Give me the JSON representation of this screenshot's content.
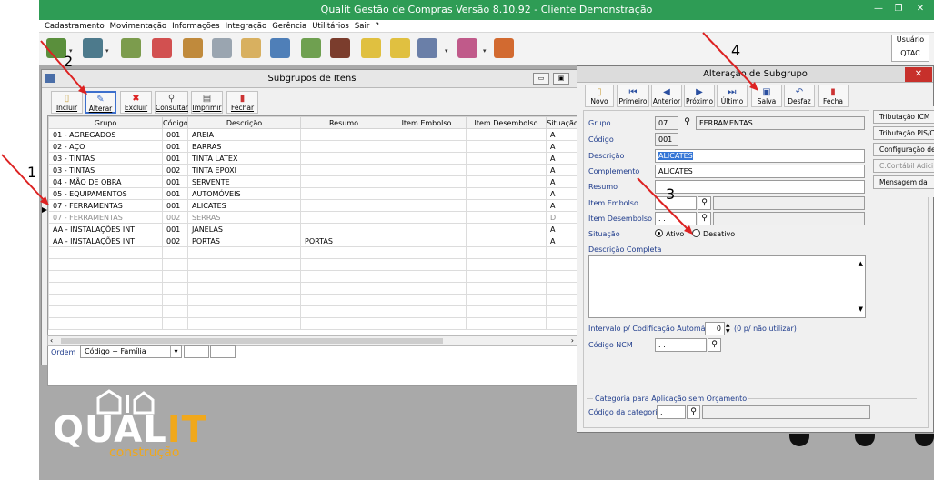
{
  "app": {
    "title": "Qualit Gestão de Compras Versão 8.10.92 - Cliente Demonstração",
    "menu": [
      "Cadastramento",
      "Movimentação",
      "Informações",
      "Integração",
      "Gerência",
      "Utilitários",
      "Sair",
      "?"
    ],
    "user_label": "Usuário",
    "user_value": "QTAC"
  },
  "colors": {
    "titlebar": "#2e9c55",
    "accent": "#1f3c8c",
    "close": "#c7302b",
    "logo_orange": "#f0a81c"
  },
  "subgroups": {
    "title": "Subgrupos de Itens",
    "buttons": [
      "Incluir",
      "Alterar",
      "Excluir",
      "Consultar",
      "Imprimir",
      "Fechar"
    ],
    "columns": [
      "Grupo",
      "Código",
      "Descrição",
      "Resumo",
      "Item Embolso",
      "Item Desembolso",
      "Situação"
    ],
    "rows": [
      [
        "01 - AGREGADOS",
        "001",
        "AREIA",
        "",
        "",
        "",
        "A"
      ],
      [
        "02 - AÇO",
        "001",
        "BARRAS",
        "",
        "",
        "",
        "A"
      ],
      [
        "03 - TINTAS",
        "001",
        "TINTA LATEX",
        "",
        "",
        "",
        "A"
      ],
      [
        "03 - TINTAS",
        "002",
        "TINTA EPOXI",
        "",
        "",
        "",
        "A"
      ],
      [
        "04 - MÃO DE OBRA",
        "001",
        "SERVENTE",
        "",
        "",
        "",
        "A"
      ],
      [
        "05 - EQUIPAMENTOS",
        "001",
        "AUTOMÓVEIS",
        "",
        "",
        "",
        "A"
      ],
      [
        "07 - FERRAMENTAS",
        "001",
        "ALICATES",
        "",
        "",
        "",
        "A"
      ],
      [
        "07 - FERRAMENTAS",
        "002",
        "SERRAS",
        "",
        "",
        "",
        "D"
      ],
      [
        "AA - INSTALAÇÕES INT",
        "001",
        "JANELAS",
        "",
        "",
        "",
        "A"
      ],
      [
        "AA - INSTALAÇÕES INT",
        "002",
        "PORTAS",
        "PORTAS",
        "",
        "",
        "A"
      ]
    ],
    "ordem_label": "Ordem",
    "ordem_value": "Código + Família"
  },
  "alteracao": {
    "title": "Alteração de Subgrupo",
    "buttons": [
      "Novo",
      "Primeiro",
      "Anterior",
      "Próximo",
      "Último",
      "Salva",
      "Desfaz",
      "Fecha"
    ],
    "grupo_label": "Grupo",
    "grupo_code": "07",
    "grupo_name": "FERRAMENTAS",
    "codigo_label": "Código",
    "codigo_value": "001",
    "descricao_label": "Descrição",
    "descricao_value": "ALICATES",
    "complemento_label": "Complemento",
    "complemento_value": "ALICATES",
    "resumo_label": "Resumo",
    "embolso_label": "Item Embolso",
    "embolso_value": ". .",
    "desembolso_label": "Item Desembolso",
    "desembolso_value": ". .",
    "situacao_label": "Situação",
    "ativo_label": "Ativo",
    "desativo_label": "Desativo",
    "desc_completa_label": "Descrição Completa",
    "intervalo_label": "Intervalo p/ Codificação Automática",
    "intervalo_value": "0",
    "intervalo_hint": "(0 p/ não utilizar)",
    "ncm_label": "Código NCM",
    "ncm_value": ". .",
    "categoria_title": "Categoria para Aplicação sem Orçamento",
    "categoria_label": "Código da categoria",
    "categoria_value": "."
  },
  "side_buttons": [
    "Tributação ICM",
    "Tributação PIS/C",
    "Configuração de F",
    "C.Contábil Adici",
    "Mensagem da"
  ],
  "logo": {
    "text_a": "QUAL",
    "text_b": "IT",
    "sub": "construção"
  },
  "markers": [
    "1",
    "2",
    "3",
    "4"
  ]
}
